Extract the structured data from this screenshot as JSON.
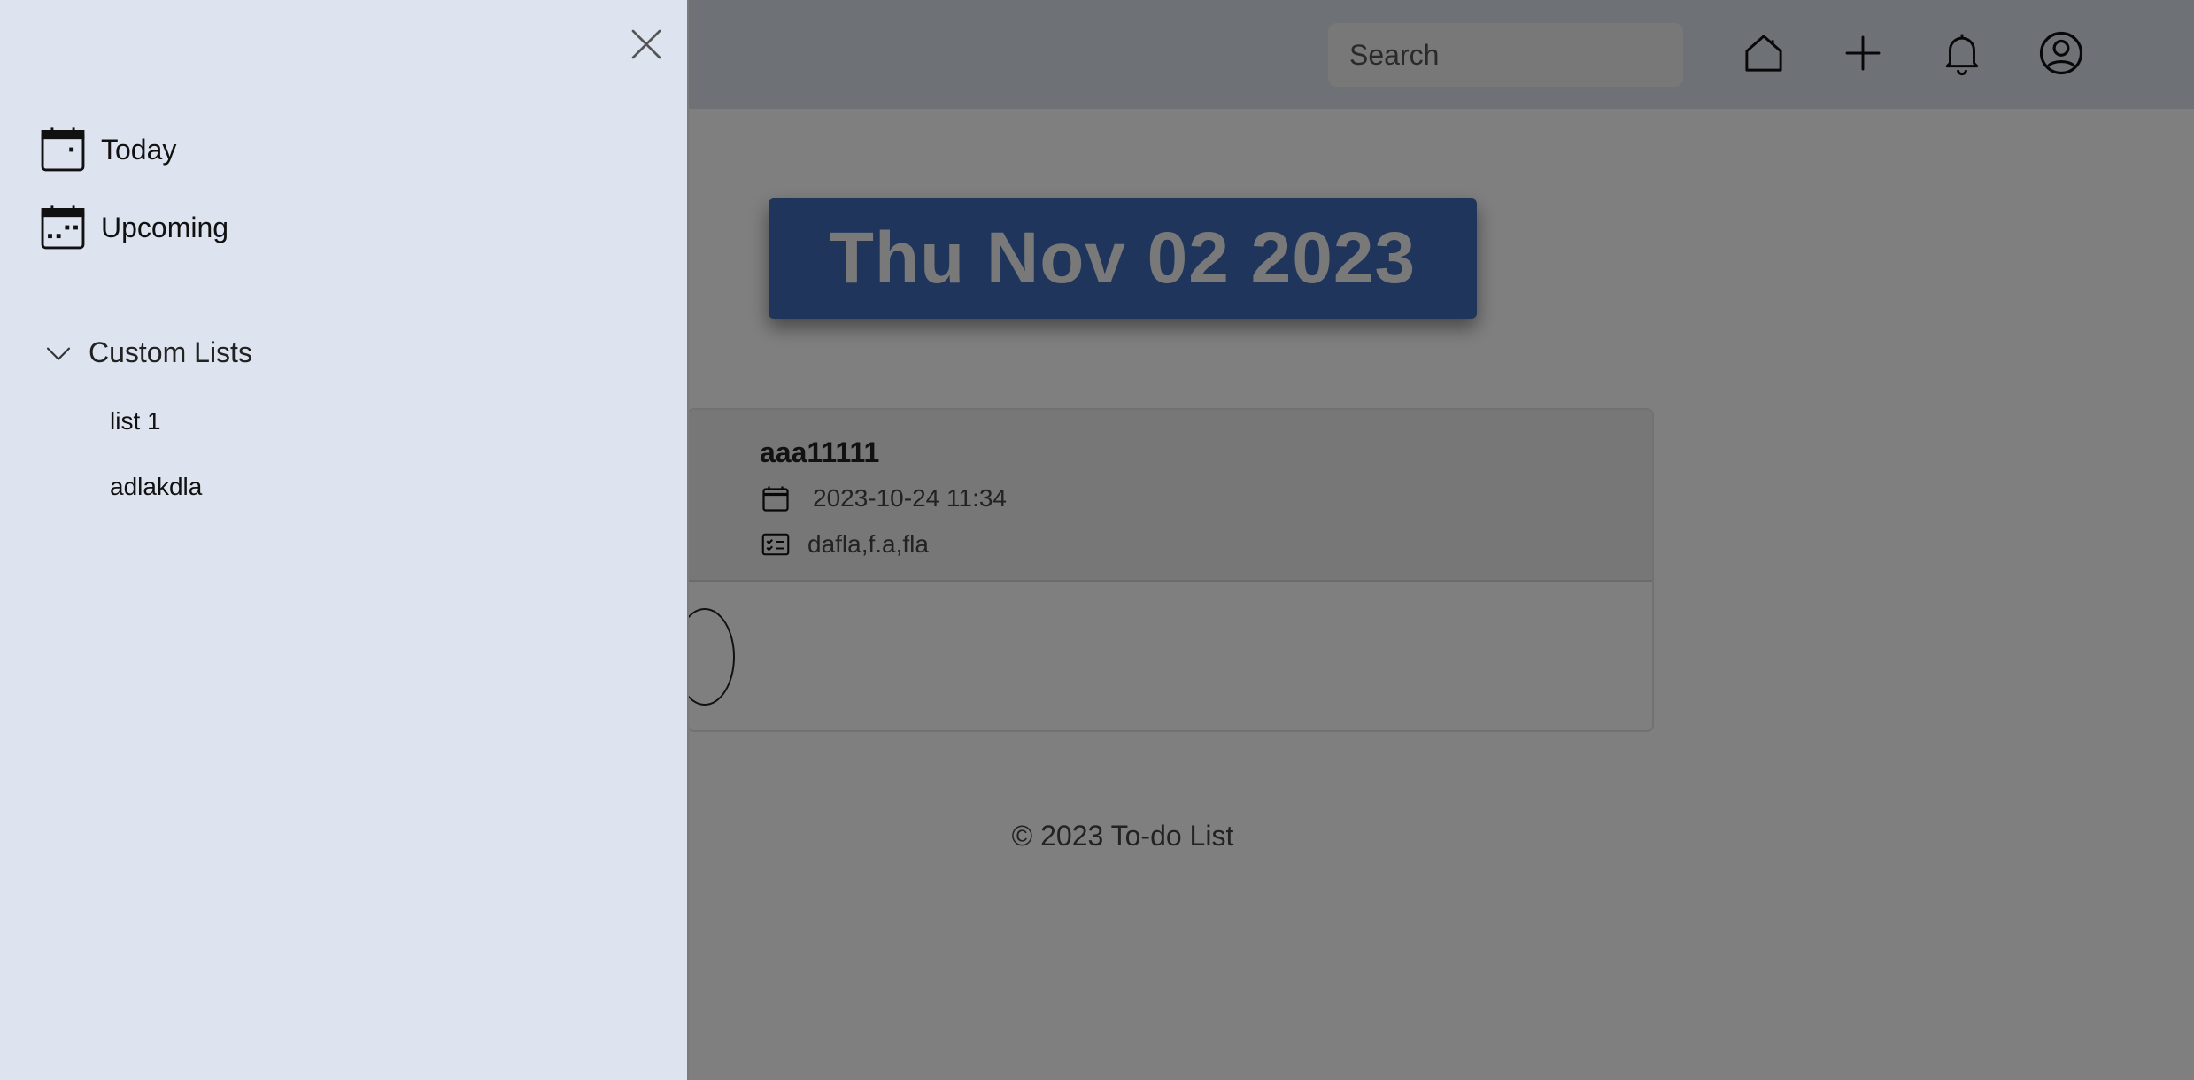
{
  "navbar": {
    "search_placeholder": "Search",
    "icons": [
      "home-icon",
      "plus-icon",
      "bell-icon",
      "user-circle-icon"
    ]
  },
  "main": {
    "date_banner": "Thu Nov 02 2023",
    "task": {
      "title": "aaa11111",
      "datetime": "2023-10-24 11:34",
      "description": "dafla,f.a,fla"
    },
    "footer": "© 2023 To-do List"
  },
  "sidebar": {
    "items": [
      {
        "label": "Today",
        "icon": "calendar-today-icon"
      },
      {
        "label": "Upcoming",
        "icon": "calendar-upcoming-icon"
      }
    ],
    "custom_lists": {
      "header": "Custom Lists",
      "lists": [
        {
          "label": "list 1"
        },
        {
          "label": "adlakdla"
        }
      ]
    }
  },
  "colors": {
    "sidebar_bg": "#dde4ef",
    "banner_bg": "#3e6bb6",
    "overlay": "rgba(0,0,0,0.5)"
  }
}
